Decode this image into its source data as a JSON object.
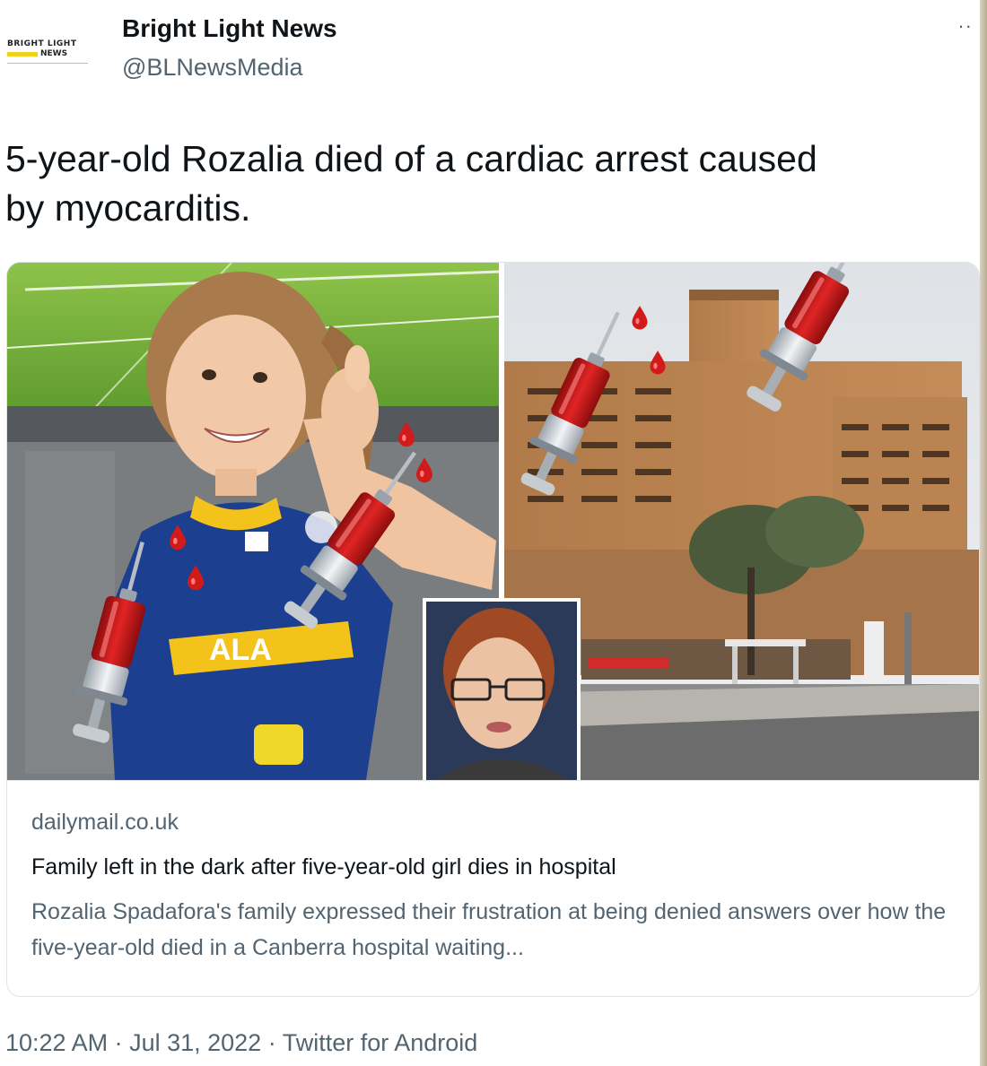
{
  "window": {
    "accent_right_edge": "#c4b89c"
  },
  "author": {
    "display_name": "Bright Light News",
    "handle": "@BLNewsMedia",
    "avatar_text_top": "BRIGHT LIGHT",
    "avatar_text_bottom": "NEWS"
  },
  "more_icon": "more-dots-icon",
  "tweet": {
    "text_line_1": "5-year-old Rozalia died of a cardiac arrest caused",
    "text_line_2": "by myocarditis."
  },
  "card": {
    "domain": "dailymail.co.uk",
    "title": "Family left in the dark after five-year-old girl dies in hospital",
    "description": "Rozalia Spadafora's family expressed their frustration at being denied answers over how the five-year-old died in a Canberra hospital waiting..."
  },
  "media": {
    "left_photo": "girl-in-football-jersey",
    "right_photo": "hospital-building",
    "inset_photo": "woman-with-glasses-portrait",
    "overlay_icon": "syringe-emoji-icon",
    "droplet_icon": "blood-drop-emoji-icon",
    "jersey_text": "ALA"
  },
  "footer": {
    "timestamp": "10:22 AM · Jul 31, 2022 · Twitter for Android"
  }
}
